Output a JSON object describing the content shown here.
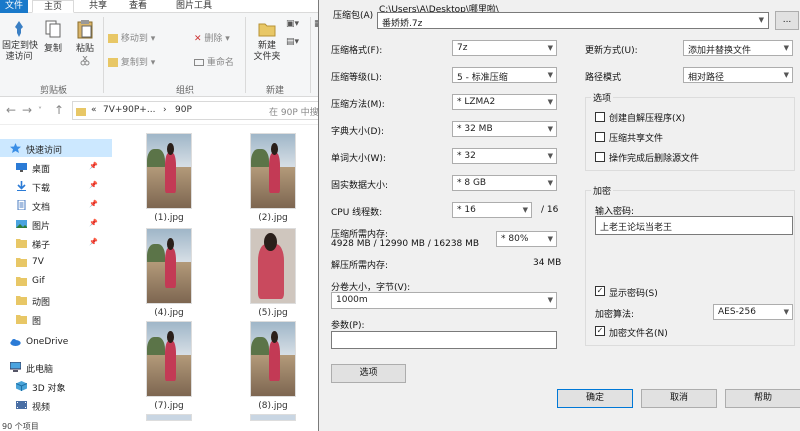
{
  "explorer": {
    "tabs": [
      "文件",
      "主页",
      "共享",
      "查看",
      "图片工具"
    ],
    "ribbon": {
      "pin_label": "固定到快\n速访问",
      "copy_label": "复制",
      "paste_label": "粘贴",
      "move_to_label": "移动到",
      "copy_to_label": "复制到",
      "delete_label": "删除",
      "rename_label": "重命名",
      "new_folder_label": "新建\n文件夹",
      "group_clipboard": "剪贴板",
      "group_organize": "组织",
      "group_new": "新建"
    },
    "address": {
      "path_part1": "«",
      "path_part2": "7V+90P+...",
      "path_part3": "›",
      "path_part4": "90P",
      "search_placeholder": "在 90P 中搜"
    },
    "nav": [
      {
        "label": "快速访问",
        "icon": "star-icon",
        "pinned": false,
        "selected": true
      },
      {
        "label": "桌面",
        "icon": "desktop-icon",
        "pinned": true
      },
      {
        "label": "下载",
        "icon": "download-icon",
        "pinned": true
      },
      {
        "label": "文档",
        "icon": "document-icon",
        "pinned": true
      },
      {
        "label": "图片",
        "icon": "picture-icon",
        "pinned": true
      },
      {
        "label": "梯子",
        "icon": "folder-icon",
        "pinned": true
      },
      {
        "label": "7V",
        "icon": "folder-icon",
        "pinned": false
      },
      {
        "label": "Gif",
        "icon": "folder-icon",
        "pinned": false
      },
      {
        "label": "动图",
        "icon": "folder-icon",
        "pinned": false
      },
      {
        "label": "图",
        "icon": "folder-icon",
        "pinned": false
      },
      {
        "label": "OneDrive",
        "icon": "cloud-icon",
        "pinned": false
      },
      {
        "label": "此电脑",
        "icon": "computer-icon",
        "pinned": false
      },
      {
        "label": "3D 对象",
        "icon": "cube-icon",
        "pinned": false
      },
      {
        "label": "视频",
        "icon": "video-icon",
        "pinned": false
      }
    ],
    "files": [
      "(1).jpg",
      "(2).jpg",
      "(4).jpg",
      "(5).jpg",
      "(7).jpg",
      "(8).jpg"
    ],
    "status": "90 个项目"
  },
  "dialog": {
    "archive_label": "压缩包(A)",
    "archive_dir": "C:\\Users\\A\\Desktop\\哪里啦\\",
    "archive_name": "番娇娇.7z",
    "browse_label": "...",
    "format_label": "压缩格式(F):",
    "format_value": "7z",
    "level_label": "压缩等级(L):",
    "level_value": "5 - 标准压缩",
    "method_label": "压缩方法(M):",
    "method_value": "* LZMA2",
    "dict_label": "字典大小(D):",
    "dict_value": "* 32 MB",
    "word_label": "单词大小(W):",
    "word_value": "* 32",
    "solid_label": "固实数据大小:",
    "solid_value": "* 8 GB",
    "threads_label": "CPU 线程数:",
    "threads_value": "* 16",
    "threads_total": "/ 16",
    "mem_label": "压缩所需内存:",
    "mem_values": "4928 MB / 12990 MB / 16238 MB",
    "mem_percent": "* 80%",
    "decomp_mem_label": "解压所需内存:",
    "decomp_mem_value": "34 MB",
    "split_label": "分卷大小，字节(V):",
    "split_value": "1000m",
    "params_label": "参数(P):",
    "params_value": "",
    "options_button": "选项",
    "update_label": "更新方式(U):",
    "update_value": "添加并替换文件",
    "pathmode_label": "路径模式",
    "pathmode_value": "相对路径",
    "options_group": "选项",
    "opt_sfx": "创建自解压程序(X)",
    "opt_shared": "压缩共享文件",
    "opt_delete": "操作完成后删除源文件",
    "encrypt_group": "加密",
    "password_label": "输入密码:",
    "password_value": "上老王论坛当老王",
    "show_password": "显示密码(S)",
    "encrypt_method_label": "加密算法:",
    "encrypt_method_value": "AES-256",
    "encrypt_names": "加密文件名(N)",
    "ok_label": "确定",
    "cancel_label": "取消",
    "help_label": "帮助"
  }
}
